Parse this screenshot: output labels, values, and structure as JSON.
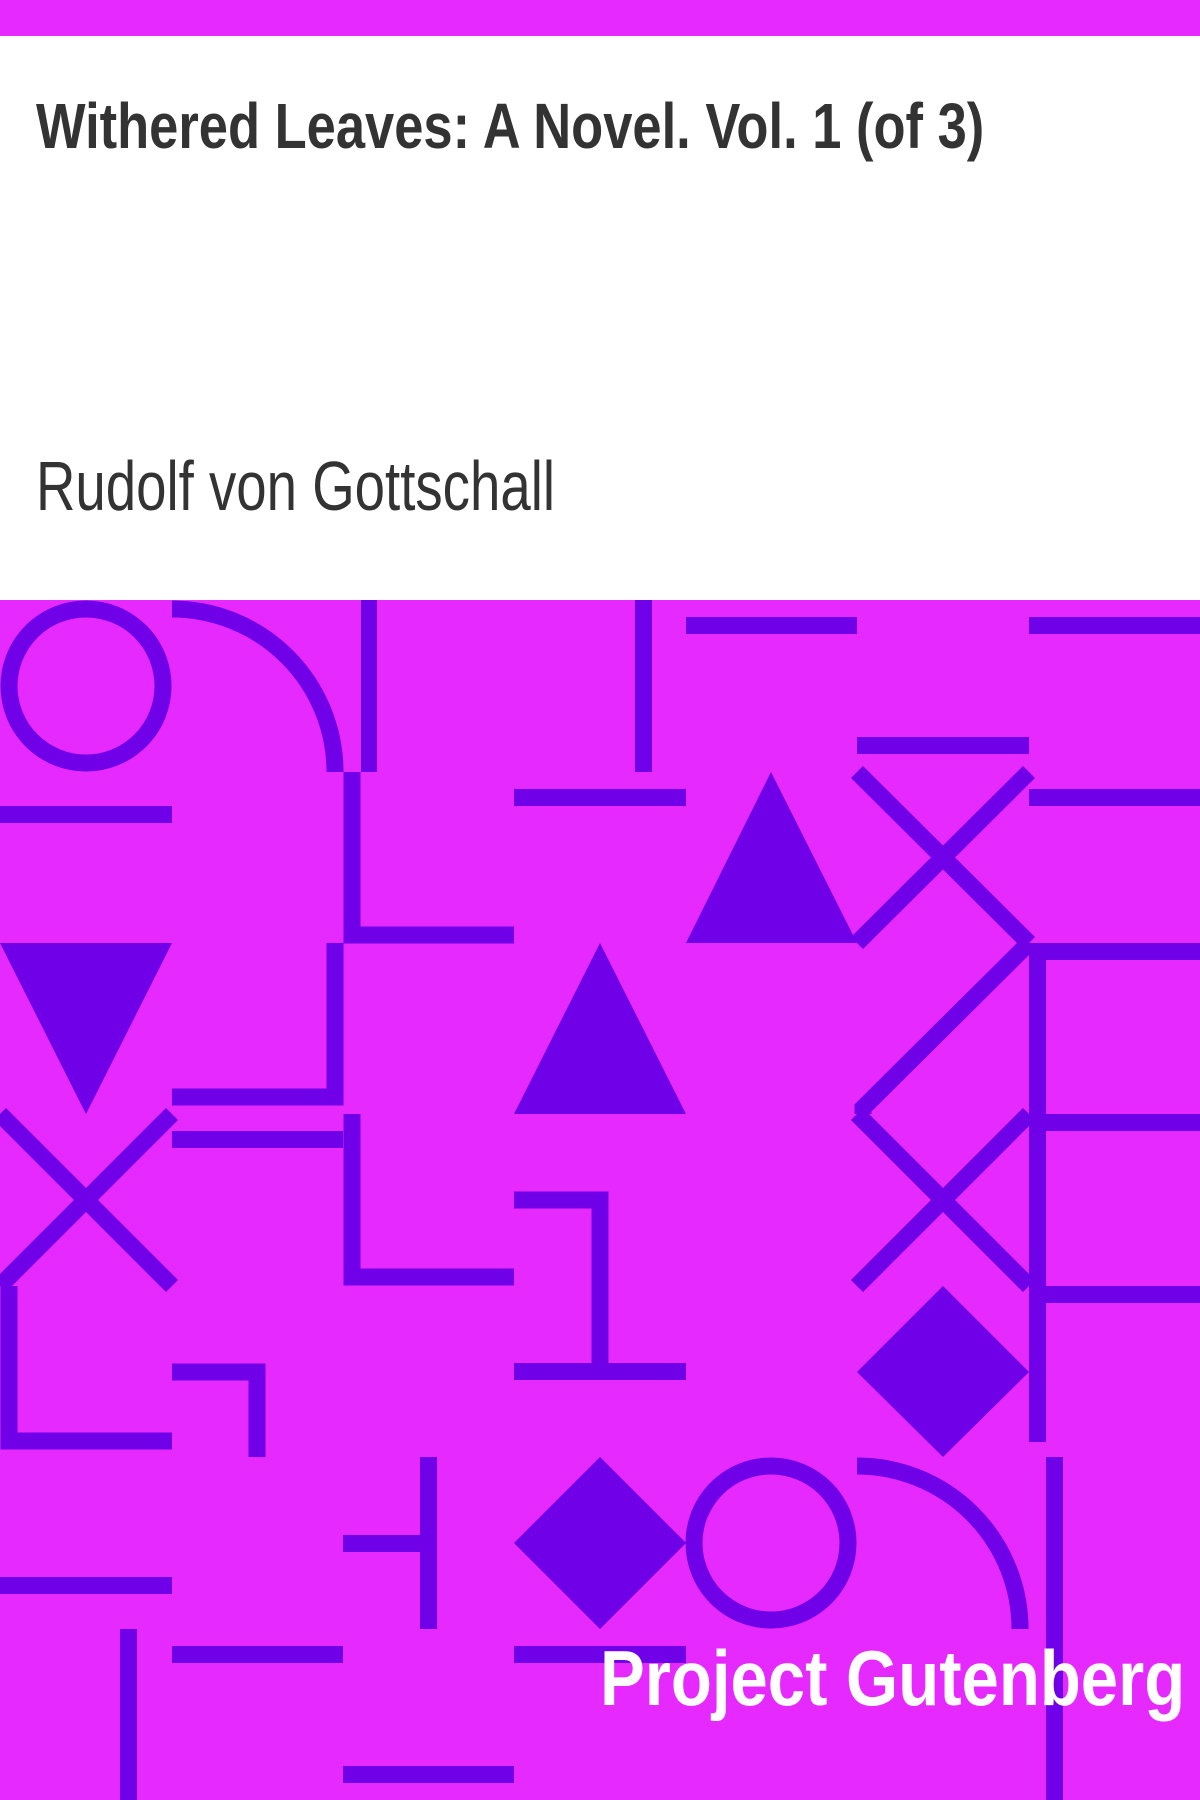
{
  "cover": {
    "title": "Withered Leaves: A Novel. Vol. 1 (of 3)",
    "author": "Rudolf von Gottschall",
    "publisher": "Project Gutenberg"
  },
  "colors": {
    "background": "#e62aff",
    "pattern": "#7000e8",
    "text_dark": "#333333",
    "text_light": "#ffffff"
  }
}
